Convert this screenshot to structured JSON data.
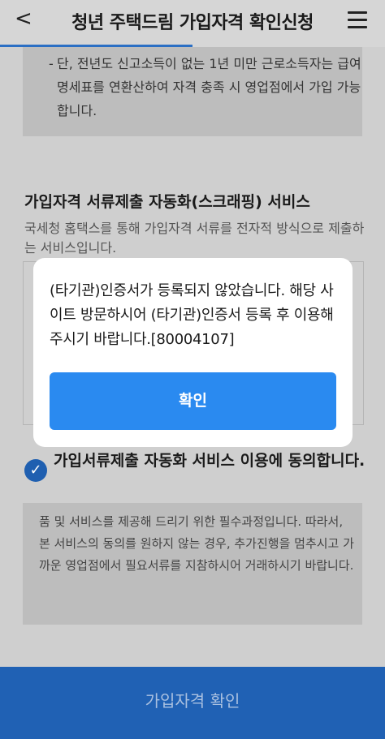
{
  "header": {
    "title": "청년 주택드림 가입자격 확인신청",
    "back_glyph": "<",
    "menu_icon": "hamburger-icon"
  },
  "notice": {
    "dash": "-",
    "text": "단, 전년도 신고소득이 없는 1년 미만 근로소득자는 급여명세표를 연환산하여 자격 충족 시 영업점에서 가입 가능합니다."
  },
  "scraping_section": {
    "title": "가입자격 서류제출 자동화(스크래핑) 서비스",
    "description": "국세청 홈택스를 통해 가입자격 서류를 전자적 방식으로 제출하는 서비스입니다."
  },
  "agreement": {
    "checked": true,
    "label": "가입서류제출 자동화 서비스 이용에 동의합니다.",
    "detail": "품 및 서비스를 제공해 드리기 위한 필수과정입니다. 따라서, 본 서비스의 동의를 원하지 않는 경우, 추가진행을 멈추시고 가까운 영업점에서 필요서류를 지참하시어 거래하시기 바랍니다."
  },
  "dialog": {
    "message": "(타기관)인증서가 등록되지 않았습니다. 해당 사이트 방문하시어 (타기관)인증서 등록 후 이용해 주시기 바랍니다.[80004107]",
    "confirm_label": "확인"
  },
  "footer": {
    "button_label": "가입자격 확인"
  },
  "colors": {
    "overlay": "#cfcfcf",
    "primary": "#2a8af0",
    "footer": "#2061b4",
    "check": "#1f5fb0"
  }
}
